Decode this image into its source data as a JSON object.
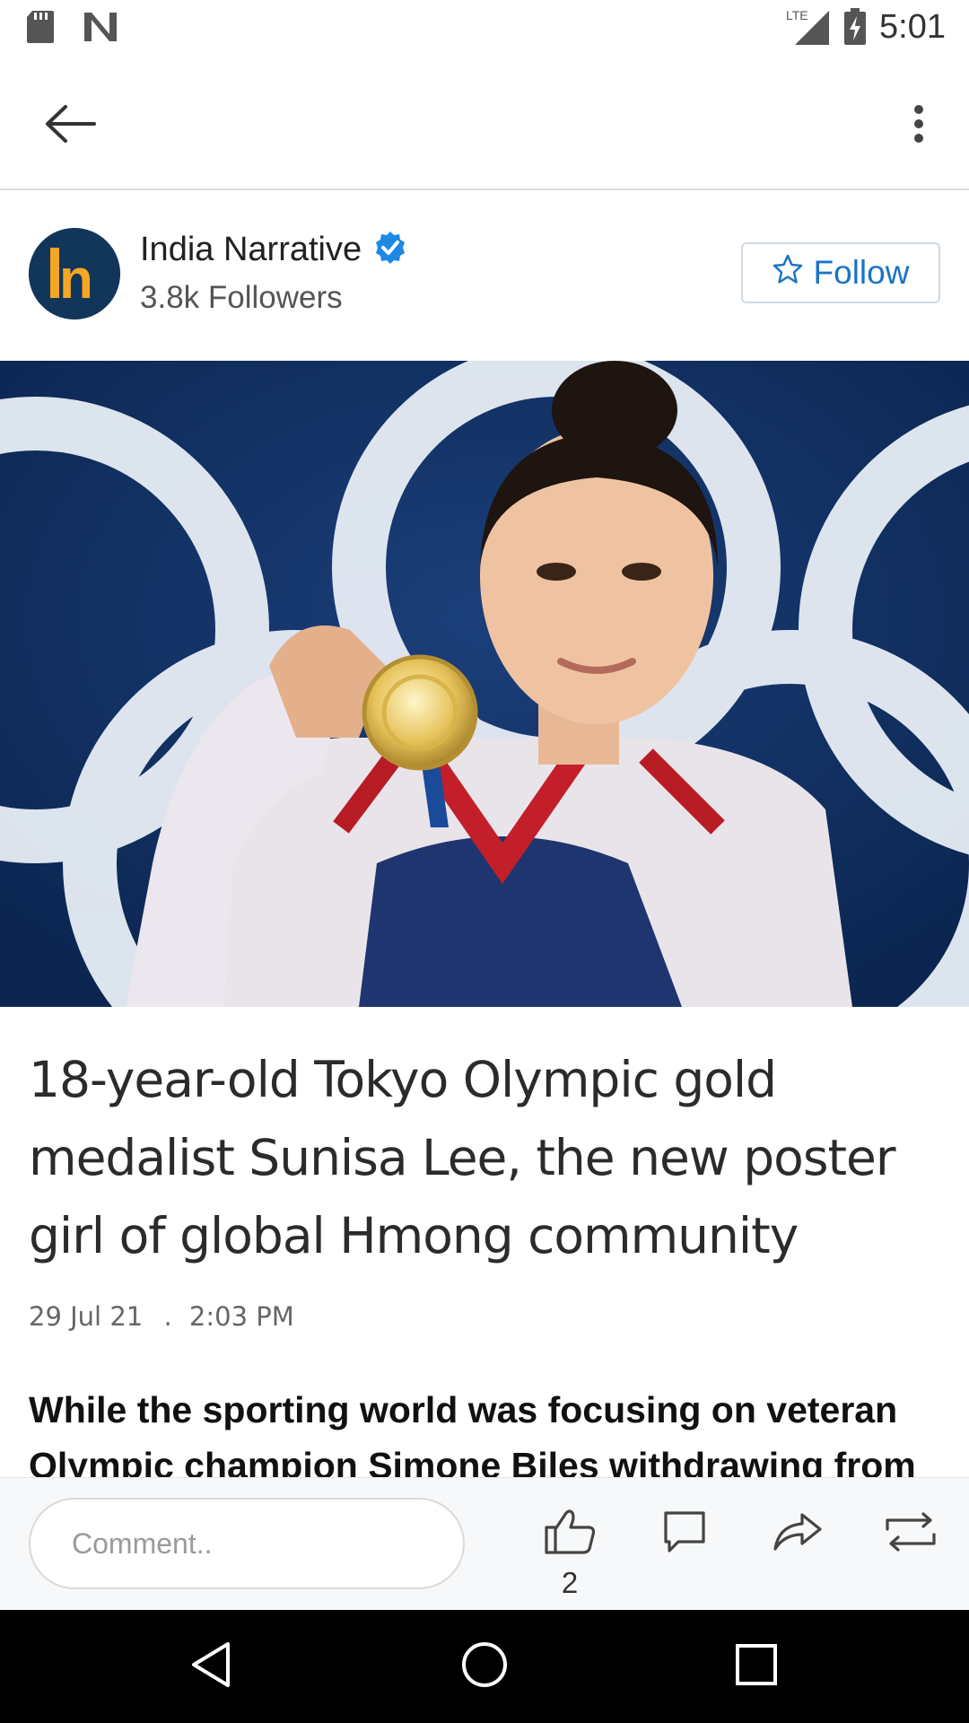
{
  "status_bar": {
    "time": "5:01",
    "network": "LTE",
    "icons": [
      "sd-card-icon",
      "n-notification-icon",
      "signal-icon",
      "battery-charging-icon"
    ]
  },
  "app_bar": {
    "back_icon": "arrow-left-icon",
    "more_icon": "more-vert-icon"
  },
  "publisher": {
    "name": "India Narrative",
    "followers": "3.8k Followers",
    "verified_icon": "verified-badge-icon",
    "follow_label": "Follow",
    "follow_icon": "star-outline-icon",
    "logo_letter": "n"
  },
  "hero": {
    "image_label": "Gymnast holding Olympic gold medal in front of Olympic rings"
  },
  "article": {
    "headline": "18-year-old Tokyo Olympic gold medalist Sunisa Lee, the new poster girl of global Hmong community",
    "date": "29 Jul 21",
    "separator": ".",
    "time": "2:03 PM",
    "body": "While the sporting world was focusing on veteran Olympic champion Simone Biles withdrawing from"
  },
  "action_bar": {
    "comment_placeholder": "Comment..",
    "like_count": "2",
    "icons": [
      "thumbs-up-icon",
      "comment-icon",
      "share-icon",
      "repost-icon"
    ]
  },
  "nav_bar": {
    "icons": [
      "nav-back-icon",
      "nav-home-icon",
      "nav-recents-icon"
    ]
  },
  "colors": {
    "accent": "#1a73c6",
    "logo_bg": "#12365a",
    "logo_accent": "#f5a623",
    "verified": "#1e88e5"
  }
}
